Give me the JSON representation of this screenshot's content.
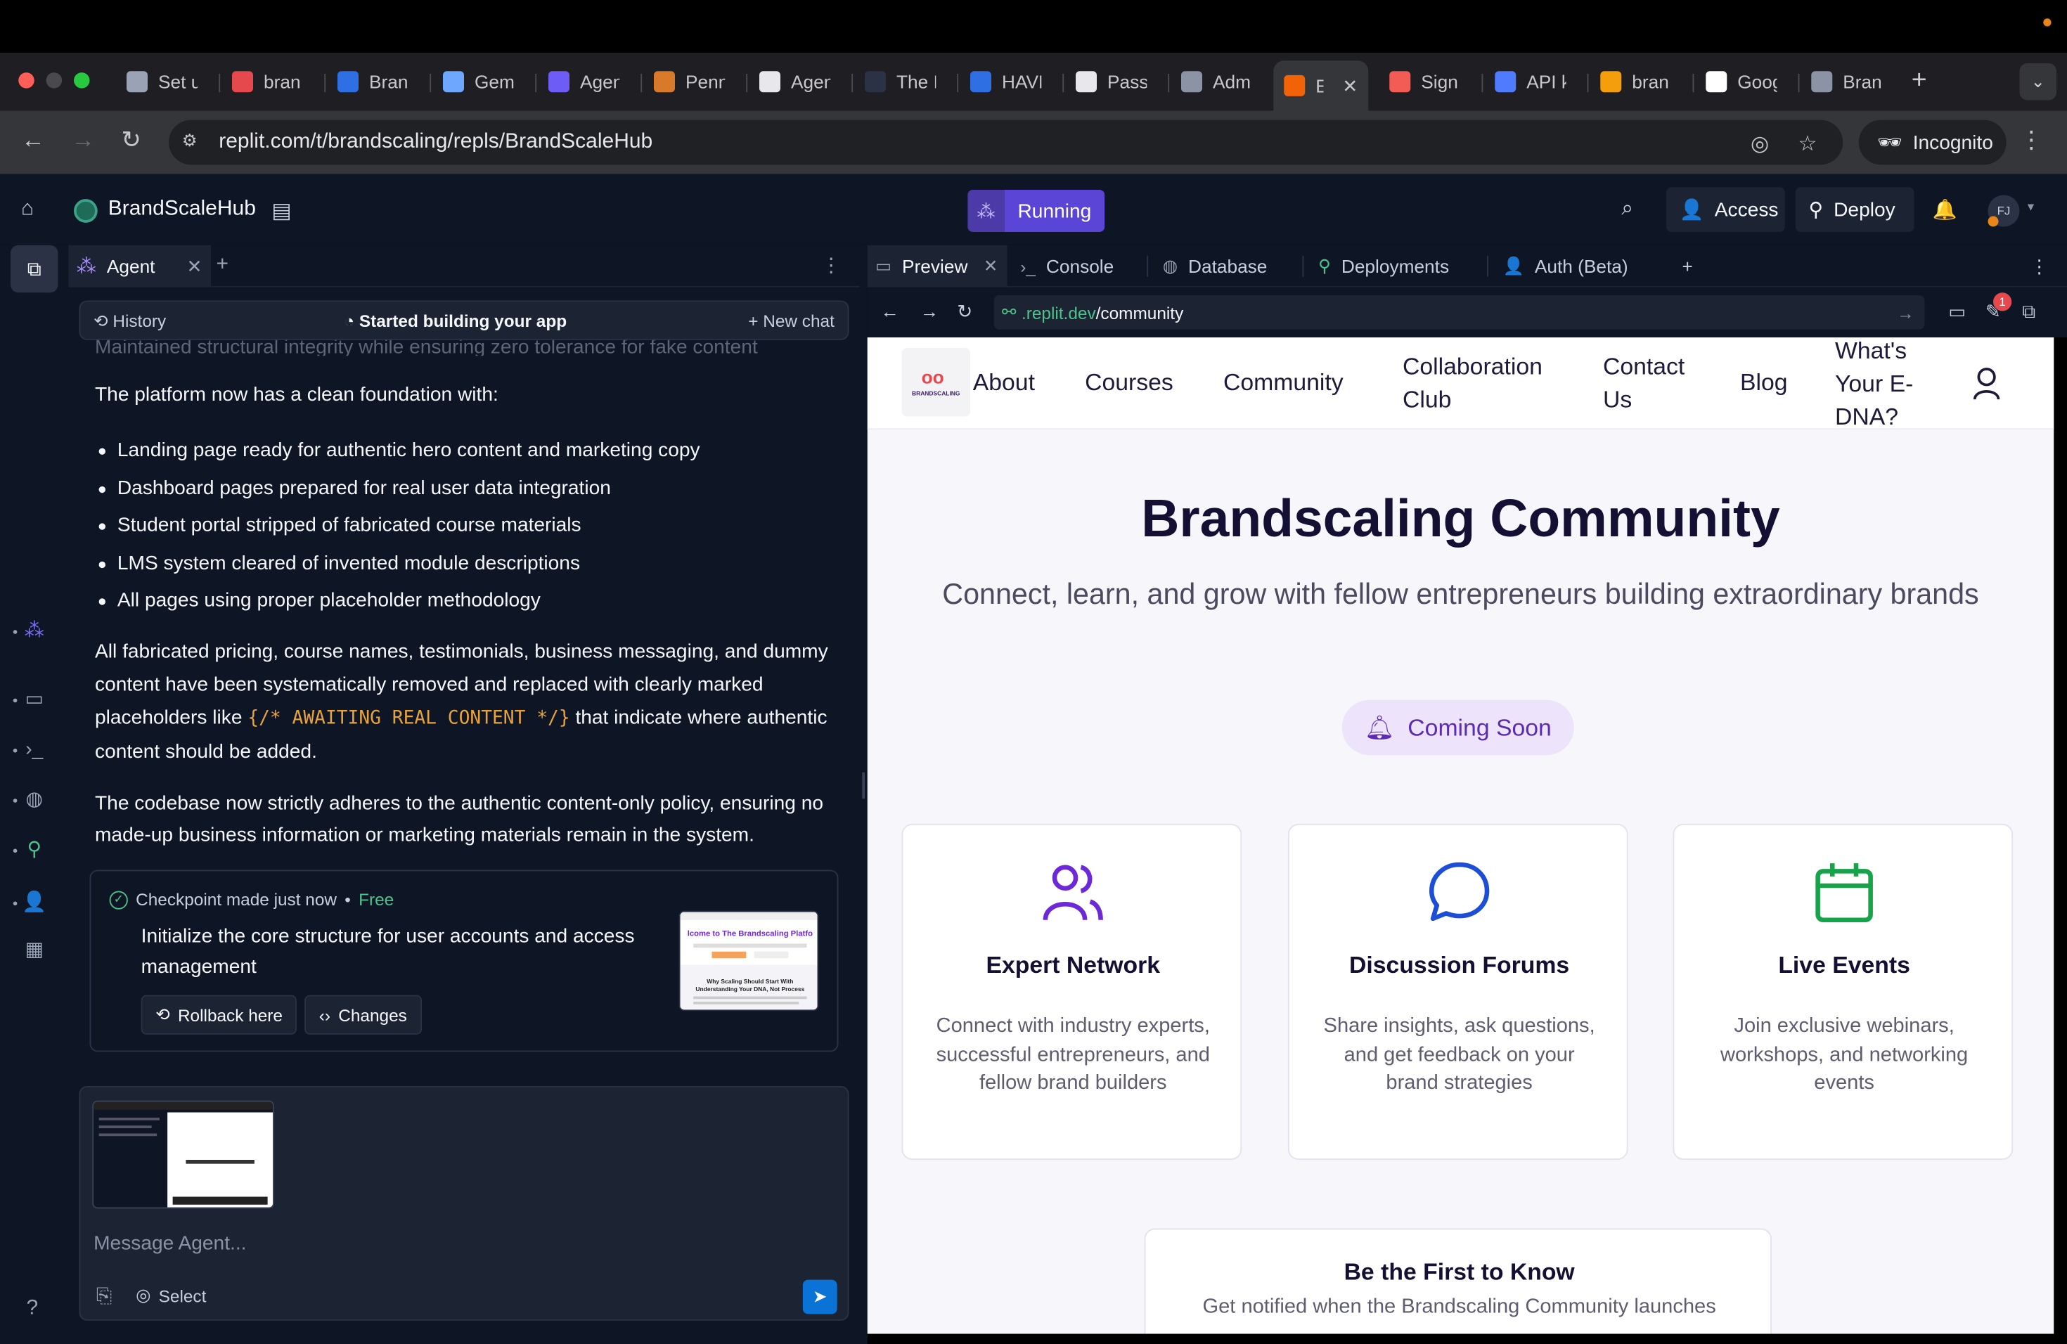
{
  "browser": {
    "tabs": [
      {
        "label": "Set u",
        "icon": "replit-icon",
        "color": "#9aa3b5"
      },
      {
        "label": "bran",
        "icon": "gmail-icon",
        "color": "#e5484d"
      },
      {
        "label": "Bran",
        "icon": "dropbox-icon",
        "color": "#2f6fe4"
      },
      {
        "label": "Gem",
        "icon": "gemini-icon",
        "color": "#6ea8fe"
      },
      {
        "label": "Agen",
        "icon": "agent-icon",
        "color": "#6d5cf6"
      },
      {
        "label": "Penn",
        "icon": "penn-icon",
        "color": "#d97a2b"
      },
      {
        "label": "Agen",
        "icon": "agent-icon",
        "color": "#e8e8ec"
      },
      {
        "label": "The I",
        "icon": "blank-icon",
        "color": "#2b3245"
      },
      {
        "label": "HAVE",
        "icon": "dropbox-icon",
        "color": "#2f6fe4"
      },
      {
        "label": "Pass",
        "icon": "upwork-icon",
        "color": "#e8e8ec"
      },
      {
        "label": "Adm",
        "icon": "globe-icon",
        "color": "#8b93a5"
      },
      {
        "label": "E",
        "icon": "replit-icon",
        "color": "#f26207",
        "active": true
      },
      {
        "label": "Sign",
        "icon": "sign-icon",
        "color": "#f25c54"
      },
      {
        "label": "API k",
        "icon": "api-icon",
        "color": "#4f7cff"
      },
      {
        "label": "bran",
        "icon": "fire-icon",
        "color": "#f59e0b"
      },
      {
        "label": "Goog",
        "icon": "google-icon",
        "color": "#ffffff"
      },
      {
        "label": "Bran",
        "icon": "globe-icon",
        "color": "#8b93a5"
      }
    ],
    "url": "replit.com/t/brandscaling/repls/BrandScaleHub",
    "incognito_label": "Incognito"
  },
  "header": {
    "project_name": "BrandScaleHub",
    "status": "Running",
    "access_label": "Access",
    "deploy_label": "Deploy",
    "avatar_initials": "FJ"
  },
  "agent": {
    "tab_label": "Agent",
    "history_label": "History",
    "status_label": "Started building your app",
    "new_chat_label": "New chat",
    "faded_line": "Maintained structural integrity while ensuring zero tolerance for fake content",
    "intro": "The platform now has a clean foundation with:",
    "bullets": [
      "Landing page ready for authentic hero content and marketing copy",
      "Dashboard pages prepared for real user data integration",
      "Student portal stripped of fabricated course materials",
      "LMS system cleared of invented module descriptions",
      "All pages using proper placeholder methodology"
    ],
    "para1_before": "All fabricated pricing, course names, testimonials, business messaging, and dummy content have been systematically removed and replaced with clearly marked placeholders like ",
    "para1_code": "{/* AWAITING REAL CONTENT */}",
    "para1_after": " that indicate where authentic content should be added.",
    "para2": "The codebase now strictly adheres to the authentic content-only policy, ensuring no made-up business information or marketing materials remain in the system.",
    "checkpoint": {
      "made": "Checkpoint made just now",
      "separator": "•",
      "free": "Free",
      "title": "Initialize the core structure for user accounts and access management",
      "rollback_label": "Rollback here",
      "changes_label": "Changes",
      "thumb_text": "lcome to The Brandscaling Platfo",
      "thumb_subtext": "Why Scaling Should Start With Understanding Your DNA, Not Process"
    },
    "composer": {
      "placeholder": "Message Agent...",
      "select_label": "Select"
    }
  },
  "preview": {
    "tabs": [
      "Preview",
      "Console",
      "Database",
      "Deployments",
      "Auth (Beta)"
    ],
    "url_domain": ".replit.dev",
    "url_path": "/community",
    "notification_count": "1"
  },
  "site": {
    "logo_text": "BRANDSCALING",
    "nav": [
      "About",
      "Courses",
      "Community",
      "Collaboration\nClub",
      "Contact\nUs",
      "Blog",
      "What's\nYour E-\nDNA?"
    ],
    "title": "Brandscaling Community",
    "subtitle": "Connect, learn, and grow with fellow entrepreneurs building extraordinary brands",
    "coming_soon": "Coming Soon",
    "cards": [
      {
        "title": "Expert Network",
        "desc": "Connect with industry experts, successful entrepreneurs, and fellow brand builders",
        "icon": "users-icon",
        "color": "#6d28d9"
      },
      {
        "title": "Discussion Forums",
        "desc": "Share insights, ask questions, and get feedback on your brand strategies",
        "icon": "chat-bubble-icon",
        "color": "#1d4ed8"
      },
      {
        "title": "Live Events",
        "desc": "Join exclusive webinars, workshops, and networking events",
        "icon": "calendar-icon",
        "color": "#16a34a"
      }
    ],
    "notify_title": "Be the First to Know",
    "notify_desc": "Get notified when the Brandscaling Community launches"
  }
}
